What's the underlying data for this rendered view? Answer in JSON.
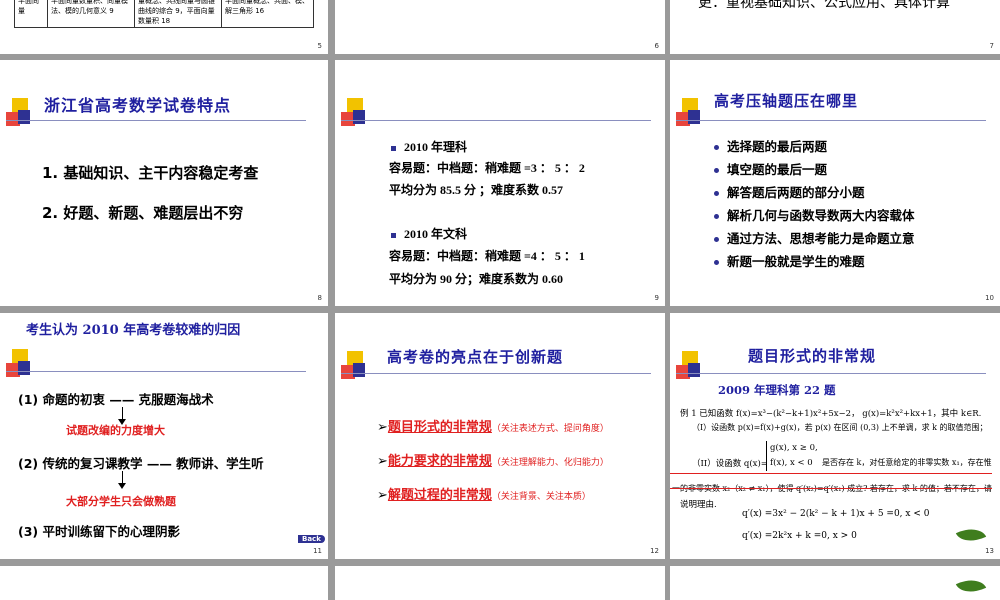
{
  "slides": {
    "s5": {
      "num": "5",
      "rowhead": "平面向量",
      "cell1": "平面向量数量积、向量模法、模的几何意义 9",
      "cell2": "量概念、共线向量与圆锥曲线的综合 9，平面向量数量积 18",
      "cell3": "平面向量概念、共面、模、解三角形 16"
    },
    "s6": {
      "num": "6"
    },
    "s7": {
      "num": "7",
      "text": "更：重视基础知识、公式应用、具体计算"
    },
    "s8": {
      "num": "8",
      "title": "浙江省高考数学试卷特点",
      "items": [
        "1.  基础知识、主干内容稳定考查",
        "2.  好题、新题、难题层出不穷"
      ]
    },
    "s9": {
      "num": "9",
      "h1": "2010 年理科",
      "l1": "容易题：中档题：稍难题 =3 ： 5 ： 2",
      "l2": "平均分为 85.5 分 ；难度系数 0.57",
      "h2": "2010 年文科",
      "l3": "容易题：中档题：稍难题 =4 ： 5 ： 1",
      "l4": "平均分为 90 分；难度系数为 0.60"
    },
    "s10": {
      "num": "10",
      "title": "高考压轴题压在哪里",
      "items": [
        "选择题的最后两题",
        "填空题的最后一题",
        "解答题后两题的部分小题",
        "解析几何与函数导数两大内容载体",
        "通过方法、思想考能力是命题立意",
        "新题一般就是学生的难题"
      ]
    },
    "s11": {
      "num": "11",
      "title": "考生认为 2010 年高考卷较难的归因",
      "i1": "(1) 命题的初衷 —— 克服题海战术",
      "r1": "试题改编的力度增大",
      "i2": "(2) 传统的复习课教学 —— 教师讲、学生听",
      "r2": "大部分学生只会做熟题",
      "i3": "(3) 平时训练留下的心理阴影",
      "back": "Back"
    },
    "s12": {
      "num": "12",
      "title": "高考卷的亮点在于创新题",
      "links": [
        {
          "main": "题目形式的非常规",
          "note": "（关注表述方式、提问角度）"
        },
        {
          "main": "能力要求的非常规",
          "note": "（关注理解能力、化归能力）"
        },
        {
          "main": "解题过程的非常规",
          "note": "（关注背景、关注本质）"
        }
      ]
    },
    "s13": {
      "num": "13",
      "title": "题目形式的非常规",
      "sub": "2009 年理科第 22 题",
      "m1": "例 1   已知函数 f(x)=x³−(k²−k+1)x²+5x−2， g(x)=k²x²+kx+1，其中 k∈R.",
      "m2": "（I）设函数 p(x)=f(x)+g(x)，若 p(x) 在区间 (0,3) 上不单调，求 k 的取值范围；",
      "m3a": "（II）设函数 q(x)=",
      "m3b": "g(x), x ≥ 0,",
      "m3c": "f(x), x < 0",
      "m3d": "是否存在 k，对任意给定的非零实数 x₁，存在惟",
      "m4": "一的非零实数 x₂（x₂ ≠ x₁），使得 q′(x₂)=q′(x₁) 成立? 若存在，求 k 的值；若不存在，请",
      "m5": "说明理由.",
      "e1": "q′(x) =3x² − 2(k² − k + 1)x + 5 =0, x < 0",
      "e2": "q′(x) =2k²x + k =0, x > 0"
    }
  }
}
